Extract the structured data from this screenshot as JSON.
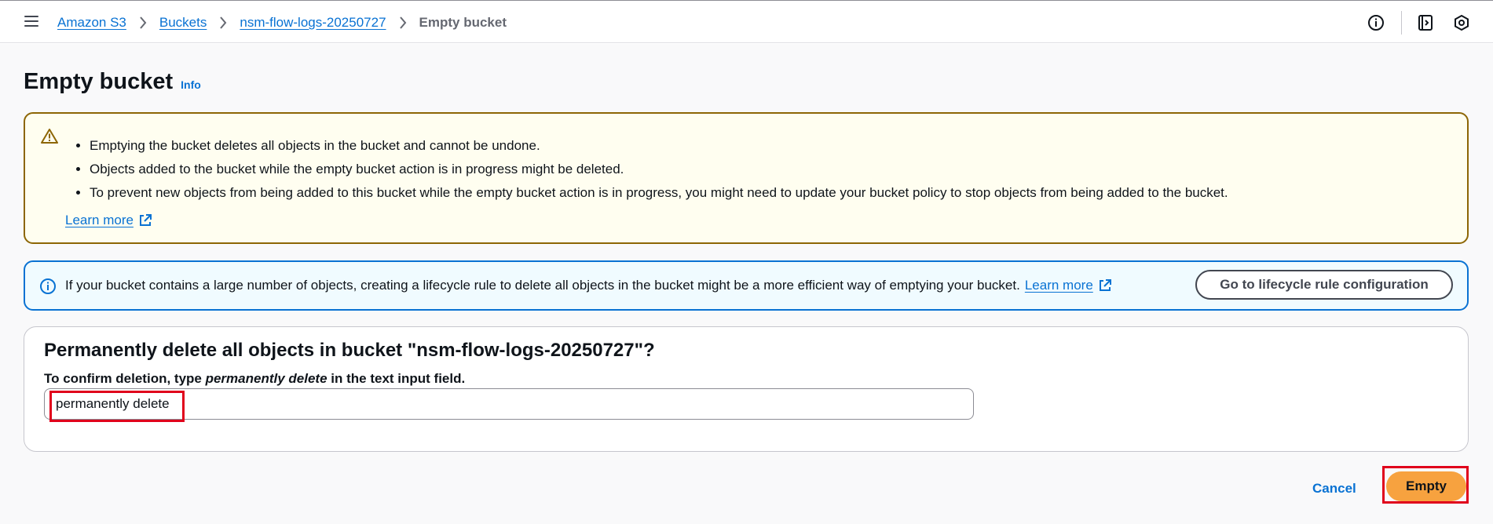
{
  "breadcrumb": {
    "items": [
      "Amazon S3",
      "Buckets",
      "nsm-flow-logs-20250727"
    ],
    "current": "Empty bucket"
  },
  "header_icons": [
    "info-circle-icon",
    "side-panel-icon",
    "settings-hex-icon"
  ],
  "page": {
    "title": "Empty bucket",
    "info_link": "Info"
  },
  "warning": {
    "icon": "warning-icon",
    "bullets": [
      "Emptying the bucket deletes all objects in the bucket and cannot be undone.",
      "Objects added to the bucket while the empty bucket action is in progress might be deleted.",
      "To prevent new objects from being added to this bucket while the empty bucket action is in progress, you might need to update your bucket policy to stop objects from being added to the bucket."
    ],
    "learn_more": "Learn more"
  },
  "info_alert": {
    "icon": "info-icon",
    "text": "If your bucket contains a large number of objects, creating a lifecycle rule to delete all objects in the bucket might be a more efficient way of emptying your bucket.",
    "learn_more": "Learn more",
    "button": "Go to lifecycle rule configuration"
  },
  "confirm": {
    "heading": "Permanently delete all objects in bucket \"nsm-flow-logs-20250727\"?",
    "label_prefix": "To confirm deletion, type ",
    "label_emphasis": "permanently delete",
    "label_suffix": " in the text input field.",
    "input_value": "permanently delete"
  },
  "actions": {
    "cancel": "Cancel",
    "empty": "Empty"
  },
  "colors": {
    "link": "#0972d3",
    "warning_border": "#8d6605",
    "warning_bg": "#fffef0",
    "info_border": "#0972d3",
    "info_bg": "#f0fbff",
    "primary_button": "#f7a23f",
    "highlight": "#e0001b"
  }
}
